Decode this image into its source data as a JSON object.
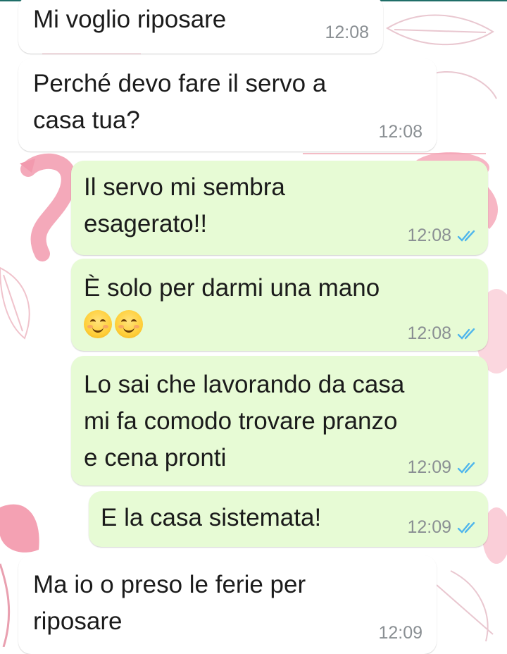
{
  "messages": [
    {
      "direction": "incoming",
      "text": "Mi voglio riposare",
      "time": "12:08"
    },
    {
      "direction": "incoming",
      "text": "Perché devo fare il servo a\ncasa tua?",
      "time": "12:08"
    },
    {
      "direction": "outgoing",
      "text": "Il servo mi sembra\nesagerato!!",
      "time": "12:08",
      "status": "read"
    },
    {
      "direction": "outgoing",
      "text": "È solo per darmi una mano",
      "emojis": [
        "smiling-face-emoji",
        "smiling-face-emoji"
      ],
      "time": "12:08",
      "status": "read"
    },
    {
      "direction": "outgoing",
      "text": "Lo sai che lavorando da casa\nmi fa comodo trovare pranzo\ne cena pronti",
      "time": "12:09",
      "status": "read"
    },
    {
      "direction": "outgoing",
      "text": "E la casa sistemata!",
      "time": "12:09",
      "status": "read"
    },
    {
      "direction": "incoming",
      "text": "Ma io o preso le ferie per\nriposare",
      "time": "12:09"
    }
  ],
  "colors": {
    "incoming_bubble": "#ffffff",
    "outgoing_bubble": "#e7fbd5",
    "read_ticks": "#4fb6ec",
    "timestamp": "#8a8f93",
    "wallpaper_accent": "#f4a6b4"
  },
  "wallpaper": "flamingo-and-leaf-pattern"
}
